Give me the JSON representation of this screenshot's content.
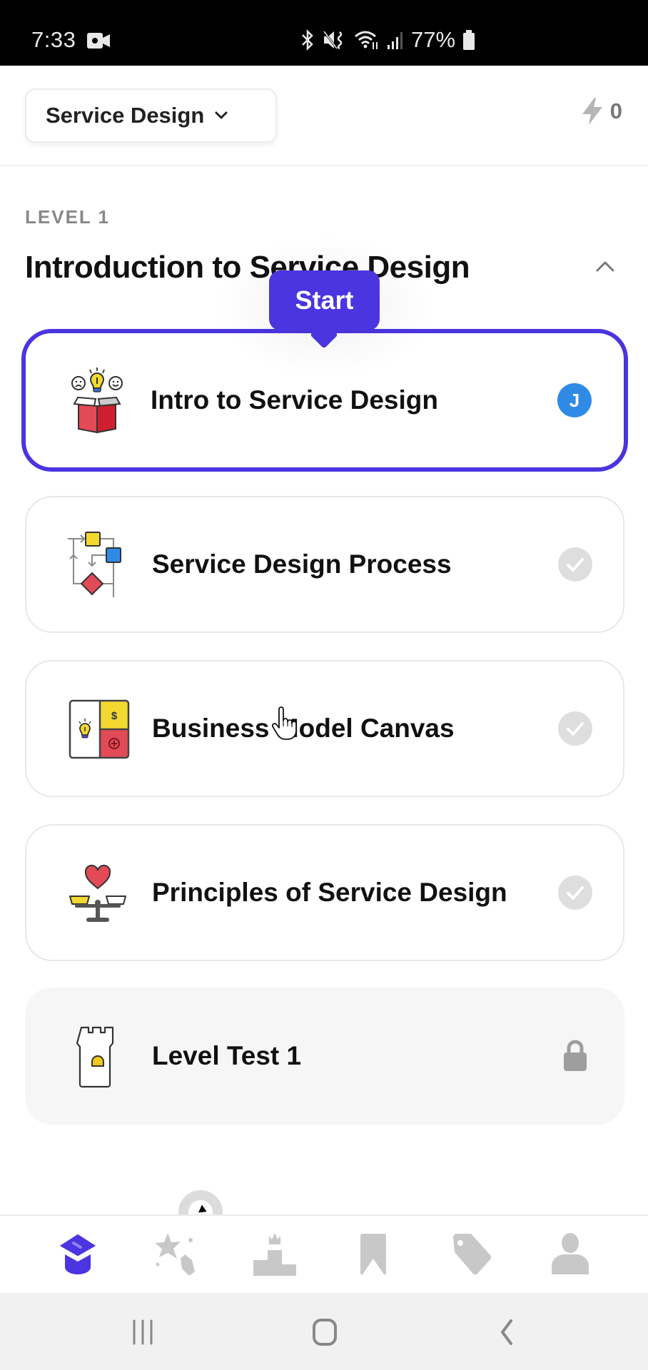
{
  "status_bar": {
    "time": "7:33",
    "battery": "77%",
    "icons": [
      "video-record-icon",
      "bluetooth-icon",
      "mute-vibrate-icon",
      "wifi-icon",
      "signal-icon",
      "battery-icon"
    ]
  },
  "header": {
    "course_selector": {
      "label": "Service Design",
      "icon": "chevron-down-icon"
    },
    "streak": {
      "icon": "lightning-bolt-icon",
      "count": "0"
    }
  },
  "level": {
    "label": "LEVEL 1",
    "title": "Introduction to Service Design",
    "collapse_icon": "chevron-up-icon"
  },
  "start_tooltip": {
    "label": "Start"
  },
  "lessons": [
    {
      "title": "Intro to Service Design",
      "icon": "open-box-idea-icon",
      "status": "current",
      "status_badge": "J"
    },
    {
      "title": "Service Design Process",
      "icon": "process-flowchart-icon",
      "status": "not-completed",
      "status_icon": "check-circle-icon"
    },
    {
      "title": "Business Model Canvas",
      "icon": "business-canvas-icon",
      "status": "not-completed",
      "status_icon": "check-circle-icon"
    },
    {
      "title": "Principles of Service Design",
      "icon": "balance-scale-heart-icon",
      "status": "not-completed",
      "status_icon": "check-circle-icon"
    },
    {
      "title": "Level Test 1",
      "icon": "tower-icon",
      "status": "locked",
      "status_icon": "lock-icon"
    }
  ],
  "bottom_nav": {
    "items": [
      {
        "name": "learn",
        "icon": "graduation-cap-icon",
        "active": true
      },
      {
        "name": "practice",
        "icon": "stars-icon",
        "active": false
      },
      {
        "name": "leaderboard",
        "icon": "podium-icon",
        "active": false
      },
      {
        "name": "bookmarks",
        "icon": "bookmark-icon",
        "active": false
      },
      {
        "name": "deals",
        "icon": "tag-icon",
        "active": false
      },
      {
        "name": "profile",
        "icon": "user-icon",
        "active": false
      }
    ]
  },
  "system_nav": {
    "buttons": [
      "recent-apps-icon",
      "home-icon",
      "back-icon"
    ]
  },
  "colors": {
    "accent": "#4A35E0",
    "avatar": "#2F8AE5",
    "inactive_icon": "#c8c8c8",
    "locked_card_bg": "#f6f6f6"
  }
}
